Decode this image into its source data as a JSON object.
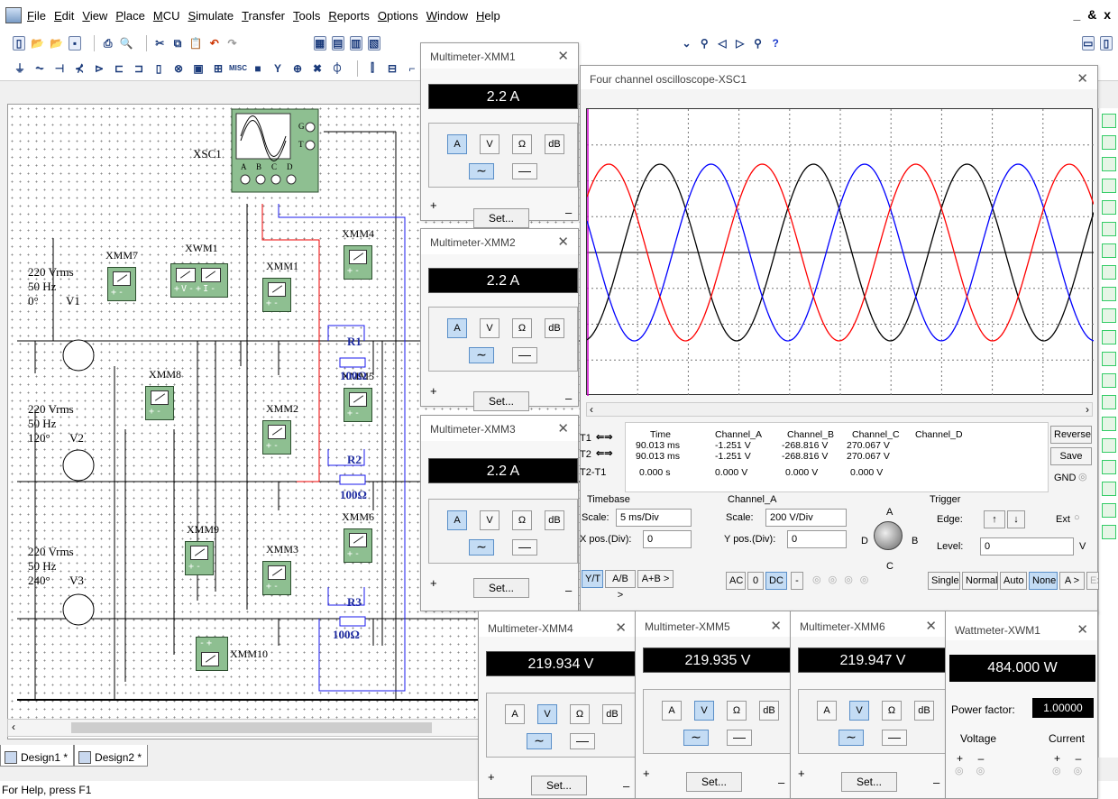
{
  "menu": [
    "File",
    "Edit",
    "View",
    "Place",
    "MCU",
    "Simulate",
    "Transfer",
    "Tools",
    "Reports",
    "Options",
    "Window",
    "Help"
  ],
  "window_controls": "_ & x",
  "schematic": {
    "xsc1": "XSC1",
    "xsc_ports": [
      "A",
      "B",
      "C",
      "D"
    ],
    "xsc_gt": [
      "G",
      "T"
    ],
    "sources": [
      {
        "name": "V1",
        "vrms": "220 Vrms",
        "freq": "50 Hz",
        "phase": "0°"
      },
      {
        "name": "V2",
        "vrms": "220 Vrms",
        "freq": "50 Hz",
        "phase": "120°"
      },
      {
        "name": "V3",
        "vrms": "220 Vrms",
        "freq": "50 Hz",
        "phase": "240°"
      }
    ],
    "meters": [
      "XMM7",
      "XWM1",
      "XMM1",
      "XMM4",
      "XMM8",
      "XMM2",
      "XMM5",
      "XMM9",
      "XMM3",
      "XMM6",
      "XMM10"
    ],
    "resistors": [
      {
        "name": "R1",
        "value": "100Ω"
      },
      {
        "name": "R2",
        "value": "100Ω"
      },
      {
        "name": "R3",
        "value": "100Ω"
      }
    ]
  },
  "tabs": [
    "Design1 *",
    "Design2 *"
  ],
  "status": "For Help, press F1",
  "multimeters": [
    {
      "title": "Multimeter-XMM1",
      "reading": "2.2 A",
      "mode": "A"
    },
    {
      "title": "Multimeter-XMM2",
      "reading": "2.2 A",
      "mode": "A"
    },
    {
      "title": "Multimeter-XMM3",
      "reading": "2.2 A",
      "mode": "A"
    },
    {
      "title": "Multimeter-XMM4",
      "reading": "219.934 V",
      "mode": "V"
    },
    {
      "title": "Multimeter-XMM5",
      "reading": "219.935 V",
      "mode": "V"
    },
    {
      "title": "Multimeter-XMM6",
      "reading": "219.947 V",
      "mode": "V"
    }
  ],
  "mm_buttons": [
    "A",
    "V",
    "Ω",
    "dB"
  ],
  "set_label": "Set...",
  "plus": "+",
  "minus": "–",
  "wattmeter": {
    "title": "Wattmeter-XWM1",
    "reading": "484.000 W",
    "pf_label": "Power factor:",
    "pf_value": "1.00000",
    "voltage": "Voltage",
    "current": "Current"
  },
  "scope": {
    "title": "Four channel oscilloscope-XSC1",
    "table_header": [
      "Time",
      "Channel_A",
      "Channel_B",
      "Channel_C",
      "Channel_D"
    ],
    "t1": [
      "90.013 ms",
      "-1.251 V",
      "-268.816 V",
      "270.067 V"
    ],
    "t2": [
      "90.013 ms",
      "-1.251 V",
      "-268.816 V",
      "270.067 V"
    ],
    "t2t1": [
      "0.000 s",
      "0.000 V",
      "0.000 V",
      "0.000 V"
    ],
    "row_labels": [
      "T1",
      "T2",
      "T2-T1"
    ],
    "reverse": "Reverse",
    "save": "Save",
    "gnd": "GND",
    "timebase": "Timebase",
    "tb_scale_label": "Scale:",
    "tb_scale": "5 ms/Div",
    "xpos_label": "X pos.(Div):",
    "xpos": "0",
    "yt_buttons": [
      "Y/T",
      "A/B >",
      "A+B >"
    ],
    "channel": "Channel_A",
    "ch_scale_label": "Scale:",
    "ch_scale": "200 V/Div",
    "ypos_label": "Y pos.(Div):",
    "ypos": "0",
    "coupling": [
      "AC",
      "0",
      "DC",
      "-"
    ],
    "knob": [
      "A",
      "B",
      "C",
      "D"
    ],
    "trigger": "Trigger",
    "edge_label": "Edge:",
    "ext": "Ext",
    "level_label": "Level:",
    "level": "0",
    "level_unit": "V",
    "trig_modes": [
      "Single",
      "Normal",
      "Auto",
      "None",
      "A >",
      "Ext"
    ],
    "colors": {
      "A": "#000000",
      "B": "#0000ff",
      "C": "#ff0000"
    }
  }
}
